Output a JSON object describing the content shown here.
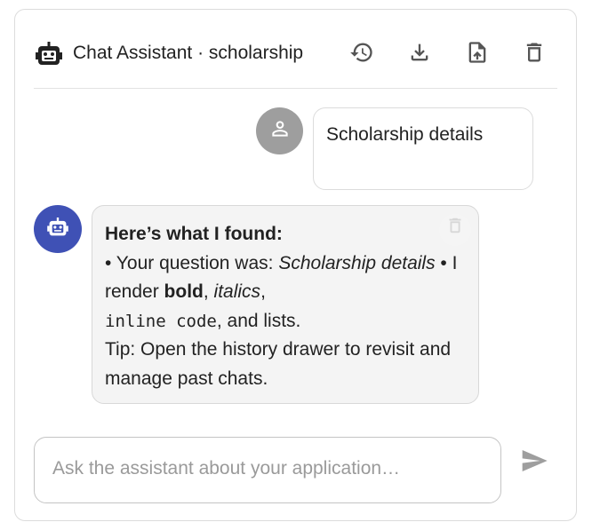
{
  "header": {
    "title": "Chat Assistant · scholarship",
    "icons": [
      "robot-icon",
      "history-icon",
      "download-icon",
      "upload-file-icon",
      "delete-icon"
    ]
  },
  "messages": [
    {
      "role": "user",
      "text": "Scholarship details"
    },
    {
      "role": "assistant",
      "heading": "Here’s what I found:",
      "line1_prefix": "• Your question was: ",
      "line1_italic": "Scholarship details",
      "line1_mid": " • I render ",
      "bold": "bold",
      "comma1": ", ",
      "italics": "italics",
      "comma2": ",",
      "code": "inline code",
      "line2_tail": ", and lists.",
      "tip": "Tip: Open the history drawer to revisit and manage past chats."
    }
  ],
  "composer": {
    "placeholder": "Ask the assistant about your application…",
    "value": ""
  },
  "colors": {
    "bot_avatar": "#3f51b5",
    "user_avatar": "#9e9e9e",
    "bot_bubble": "#f4f4f4",
    "icon": "#555555",
    "send_icon": "#9e9e9e"
  }
}
